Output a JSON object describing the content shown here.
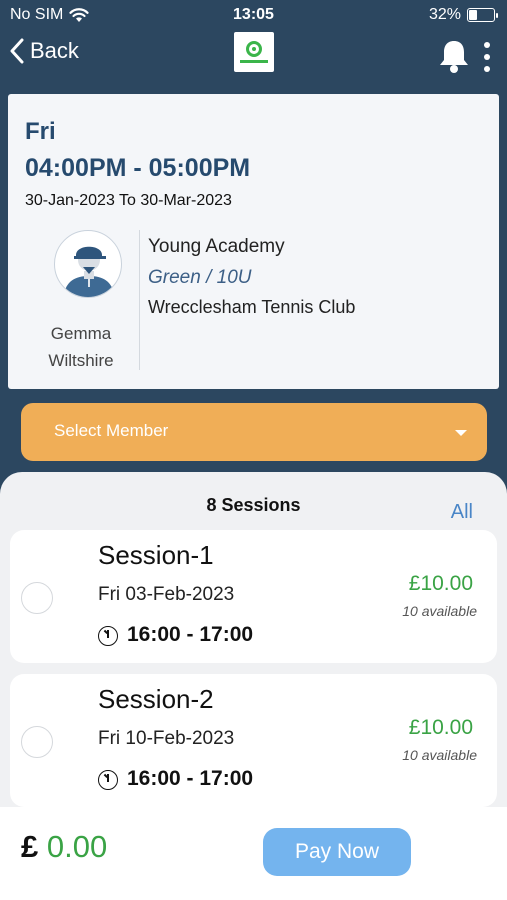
{
  "status_bar": {
    "carrier": "No SIM",
    "time": "13:05",
    "battery": "32%",
    "battery_level": 0.32
  },
  "nav": {
    "back_label": "Back",
    "logo_icon": "club-logo",
    "bell_icon": "bell-icon",
    "menu_icon": "kebab-menu-icon"
  },
  "class": {
    "day": "Fri",
    "time": "04:00PM - 05:00PM",
    "date_range": "30-Jan-2023 To 30-Mar-2023",
    "coach": {
      "first_name": "Gemma",
      "last_name": "Wiltshire"
    },
    "program": "Young Academy",
    "group": "Green / 10U",
    "venue": "Wrecclesham Tennis Club"
  },
  "member_select": {
    "placeholder": "Select Member"
  },
  "sessions": {
    "count_label": "8 Sessions",
    "all_label": "All",
    "items": [
      {
        "title": "Session-1",
        "date": "Fri 03-Feb-2023",
        "time": "16:00 - 17:00",
        "price": "£10.00",
        "availability": "10 available"
      },
      {
        "title": "Session-2",
        "date": "Fri 10-Feb-2023",
        "time": "16:00 - 17:00",
        "price": "£10.00",
        "availability": "10 available"
      }
    ]
  },
  "footer": {
    "currency": "£",
    "total": "0.00",
    "pay_label": "Pay Now"
  },
  "colors": {
    "header_bg": "#2c4760",
    "accent_orange": "#f0ae57",
    "price_green": "#3aa345",
    "pay_blue": "#74b4ee",
    "heading_blue": "#264a6e"
  }
}
